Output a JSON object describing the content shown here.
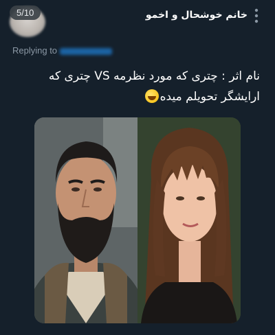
{
  "gallery": {
    "counter": "5/10"
  },
  "tweet": {
    "display_name": "خانم خوشحال و اخمو",
    "replying_to": "Replying to",
    "text_line1": "نام اثر : چتری که مورد نظرمه VS چتری که",
    "text_line2": "ارایشگر تحویلم میده",
    "emoji": "grinning-sweat-emoji"
  },
  "media": {
    "left_photo": "bearded-man-photo",
    "right_photo": "woman-with-bangs-photo"
  },
  "colors": {
    "background": "#15202b",
    "secondary_text": "#8b98a5",
    "link_blue": "#1d9bf0"
  }
}
